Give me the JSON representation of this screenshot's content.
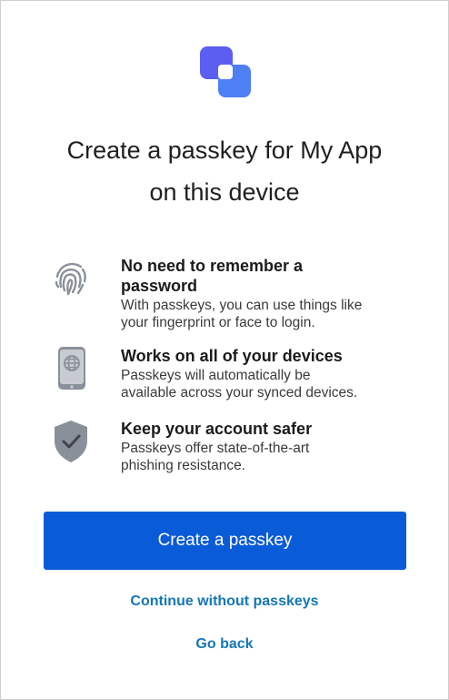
{
  "title": {
    "line1": "Create a passkey for My App",
    "line2": "on this device"
  },
  "features": [
    {
      "icon": "fingerprint-icon",
      "title_line1": "No need to remember a",
      "title_line2": "password",
      "desc_line1": "With passkeys, you can use things like",
      "desc_line2": "your fingerprint or face to login."
    },
    {
      "icon": "device-globe-icon",
      "title_line1": "Works on all of your devices",
      "desc_line1": "Passkeys will automatically be",
      "desc_line2": "available across your synced devices."
    },
    {
      "icon": "shield-check-icon",
      "title_line1": "Keep your account safer",
      "desc_line1": "Passkeys offer state-of-the-art",
      "desc_line2": "phishing resistance."
    }
  ],
  "actions": {
    "create_label": "Create a passkey",
    "continue_label": "Continue without passkeys",
    "back_label": "Go back"
  },
  "colors": {
    "primary": "#0a5bd8",
    "link": "#1477b4",
    "icon_gray": "#8a9099"
  }
}
